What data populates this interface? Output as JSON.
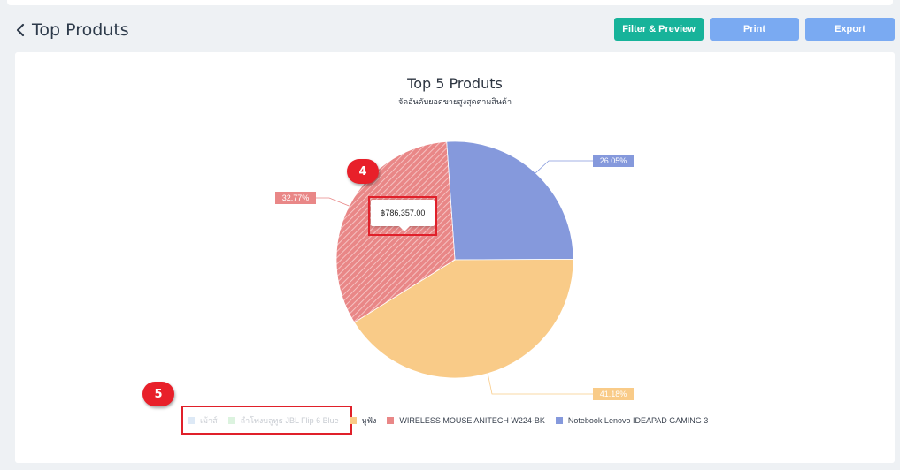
{
  "header": {
    "title": "Top Produts",
    "buttons": {
      "filter": "Filter & Preview",
      "print": "Print",
      "export": "Export"
    }
  },
  "colors": {
    "filter_button": "#17b39a",
    "action_button": "#7aaaf2",
    "annotation": "#e8202a"
  },
  "chart_data": {
    "type": "pie",
    "title": "Top 5 Produts",
    "subtitle": "จัดอันดับยอดขายสูงสุดตามสินค้า",
    "series": [
      {
        "name": "เม้าส์",
        "value": 0,
        "label": "",
        "color": "#a9c8e8",
        "visible": false
      },
      {
        "name": "ลำโพงบลูทูธ JBL Flip 6 Blue",
        "value": 0,
        "label": "",
        "color": "#a8e0b0",
        "visible": false
      },
      {
        "name": "หูฟัง",
        "value": 41.18,
        "label": "41.18%",
        "color": "#f9cb88",
        "visible": true
      },
      {
        "name": "WIRELESS MOUSE ANITECH W224-BK",
        "value": 32.77,
        "label": "32.77%",
        "color": "#e98787",
        "visible": true
      },
      {
        "name": "Notebook Lenovo IDEAPAD GAMING 3",
        "value": 26.05,
        "label": "26.05%",
        "color": "#8599dc",
        "visible": true
      }
    ],
    "legend_position": "bottom-center",
    "hovered_slice": "WIRELESS MOUSE ANITECH W224-BK",
    "tooltip_value": "฿786,357.00"
  },
  "annotations": {
    "marker_4": "4",
    "marker_5": "5"
  }
}
